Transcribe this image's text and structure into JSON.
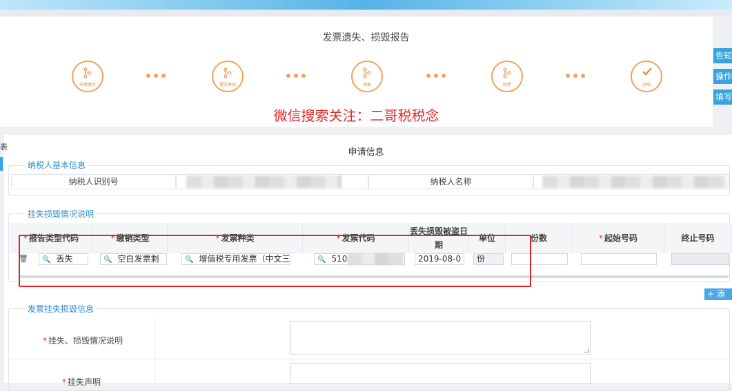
{
  "header": {
    "title": "发票遗失、损毁报告"
  },
  "steps": [
    {
      "label": "申请填写"
    },
    {
      "label": "提交审核"
    },
    {
      "label": "预审"
    },
    {
      "label": "同步"
    },
    {
      "label": "办结"
    }
  ],
  "watermark": "微信搜索关注：二哥税税念",
  "side_buttons": [
    "告知",
    "操作",
    "填写"
  ],
  "section": {
    "title": "申请信息",
    "left_edge_char": "表",
    "taxpayer": {
      "legend": "纳税人基本信息",
      "id_label": "纳税人识别号",
      "name_label": "纳税人名称"
    },
    "loss": {
      "legend": "挂失损毁情况说明",
      "columns": [
        "报告类型代码",
        "缴销类型",
        "发票种类",
        "发票代码",
        "丢失损毁被盗日期",
        "单位",
        "份数",
        "起始号码",
        "终止号码"
      ],
      "row": {
        "report_type": "丢失",
        "cancel_type": "空白发票剩",
        "invoice_kind": "增值税专用发票（中文三",
        "invoice_code": "510",
        "date": "2019-08-0",
        "unit": "份"
      },
      "add_button": "+ 添"
    },
    "invoice": {
      "legend": "发票挂失损毁信息",
      "row1_label": "挂失、损毁情况说明",
      "row2_label": "挂失声明"
    }
  },
  "colors": {
    "accent": "#36a3de",
    "step": "#f0a35e",
    "alert": "#d8232a"
  }
}
